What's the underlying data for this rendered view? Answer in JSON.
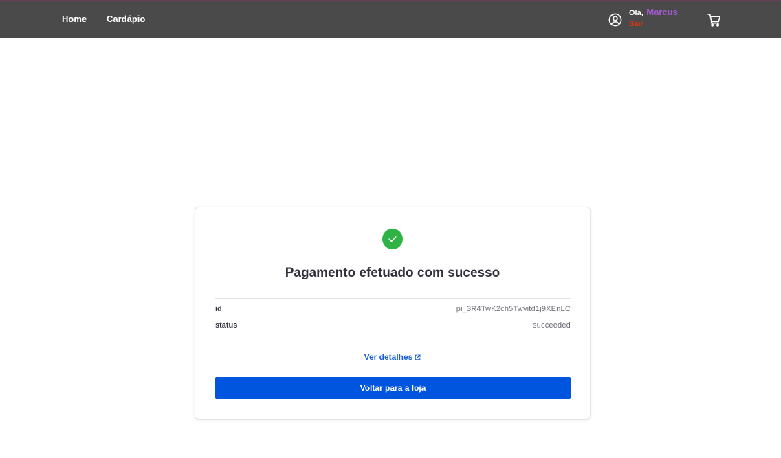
{
  "navbar": {
    "home_label": "Home",
    "menu_label": "Cardápio",
    "greeting_prefix": "Olá,",
    "user_name": "Marcus",
    "logout_label": "Sair",
    "user_icon": "user-circle-icon",
    "cart_icon": "shopping-cart-icon"
  },
  "payment": {
    "status_icon": "check-circle-icon",
    "title": "Pagamento efetuado com sucesso",
    "details": [
      {
        "key": "id",
        "value": "pi_3R4TwK2ch5Twvitd1j9XEnLC"
      },
      {
        "key": "status",
        "value": "succeeded"
      }
    ],
    "details_link_label": "Ver detalhes",
    "details_link_icon": "external-link-icon",
    "back_button_label": "Voltar para a loja"
  },
  "colors": {
    "navbar_bg": "#4a4a4a",
    "user_name": "#a25bcf",
    "logout": "#e63312",
    "success": "#2fb344",
    "link": "#1a5fd6",
    "primary_button": "#0055de"
  }
}
